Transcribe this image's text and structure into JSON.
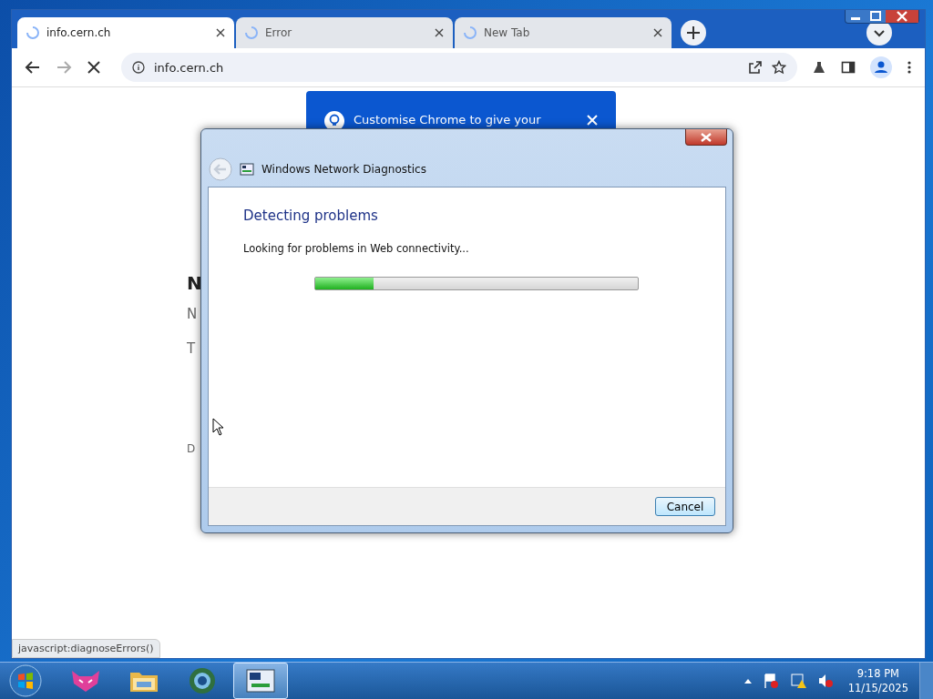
{
  "browser": {
    "tabs": [
      {
        "title": "info.cern.ch",
        "selected": true
      },
      {
        "title": "Error",
        "selected": false
      },
      {
        "title": "New Tab",
        "selected": false
      }
    ],
    "address": "info.cern.ch",
    "promo": {
      "text": "Customise Chrome to give your"
    },
    "page_fragments": [
      {
        "kind": "heading",
        "text": "N"
      },
      {
        "kind": "text",
        "text": "N"
      },
      {
        "kind": "text",
        "text": "T"
      },
      {
        "kind": "text",
        "text": "D"
      }
    ],
    "status_link": "javascript:diagnoseErrors()"
  },
  "dialog": {
    "title": "Windows Network Diagnostics",
    "heading": "Detecting problems",
    "message": "Looking for problems in Web connectivity...",
    "progress": {
      "level": 0.18
    },
    "buttons": [
      "Cancel"
    ]
  },
  "taskbar": {
    "apps": [
      {
        "kind": "fox",
        "selected": false
      },
      {
        "kind": "folder",
        "selected": false
      },
      {
        "kind": "browser",
        "selected": false
      },
      {
        "kind": "diagnostics",
        "selected": true
      }
    ],
    "time": "9:18 PM",
    "date": "11/15/2025"
  }
}
